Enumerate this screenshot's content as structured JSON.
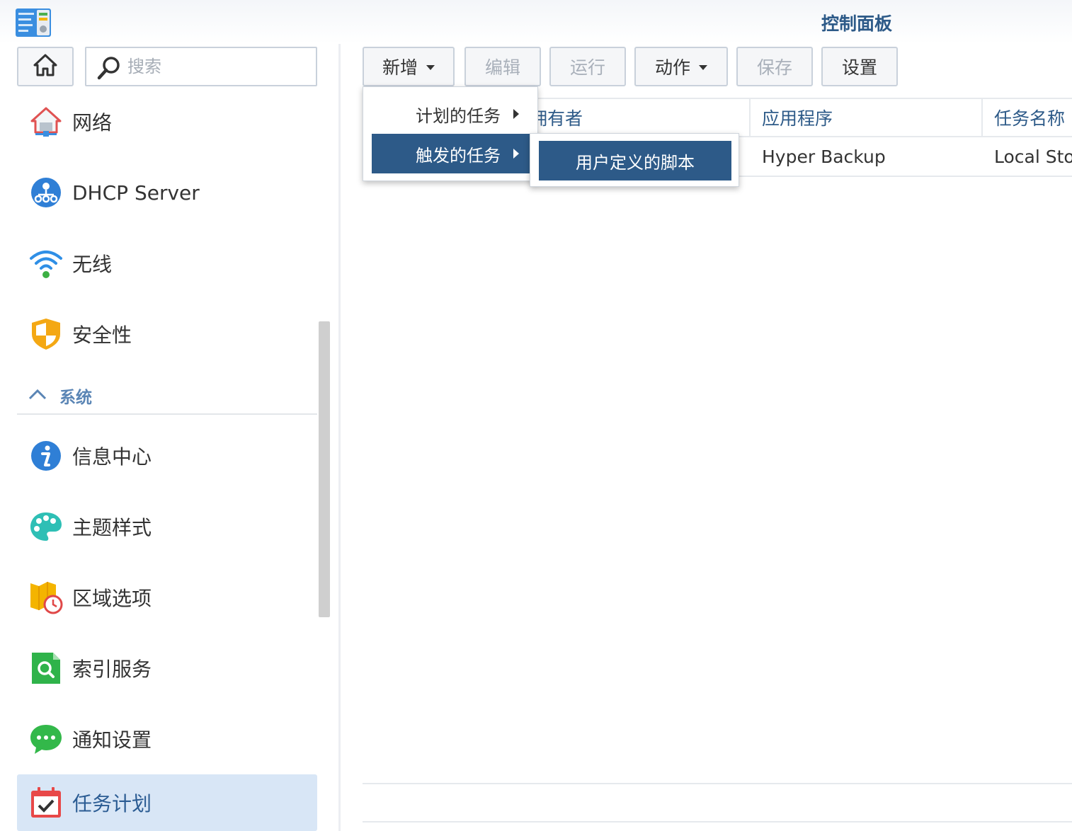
{
  "window": {
    "title": "控制面板"
  },
  "search": {
    "placeholder": "搜索"
  },
  "sidebar": {
    "items": [
      {
        "label": "网络",
        "icon": "network-icon"
      },
      {
        "label": "DHCP Server",
        "icon": "dhcp-icon"
      },
      {
        "label": "无线",
        "icon": "wifi-icon"
      },
      {
        "label": "安全性",
        "icon": "shield-icon"
      }
    ],
    "section": {
      "label": "系统",
      "icon": "chevron-up-icon"
    },
    "system_items": [
      {
        "label": "信息中心",
        "icon": "info-icon"
      },
      {
        "label": "主题样式",
        "icon": "palette-icon"
      },
      {
        "label": "区域选项",
        "icon": "map-clock-icon"
      },
      {
        "label": "索引服务",
        "icon": "index-search-icon"
      },
      {
        "label": "通知设置",
        "icon": "chat-bubble-icon"
      },
      {
        "label": "任务计划",
        "icon": "calendar-check-icon",
        "active": true
      }
    ]
  },
  "toolbar": {
    "create": "新增",
    "edit": "编辑",
    "run": "运行",
    "action": "动作",
    "save": "保存",
    "settings": "设置"
  },
  "table": {
    "columns": [
      "拥有者",
      "应用程序",
      "任务名称"
    ],
    "rows": [
      {
        "owner": "",
        "application": "Hyper Backup",
        "task_name": "Local Sto"
      }
    ]
  },
  "menu": {
    "items": [
      {
        "label": "计划的任务"
      },
      {
        "label": "触发的任务",
        "highlighted": true
      }
    ],
    "submenu": {
      "label": "用户定义的脚本"
    }
  },
  "colors": {
    "accent": "#2d5a88",
    "active_bg": "#d8e6f6",
    "section_text": "#5a85b5"
  }
}
